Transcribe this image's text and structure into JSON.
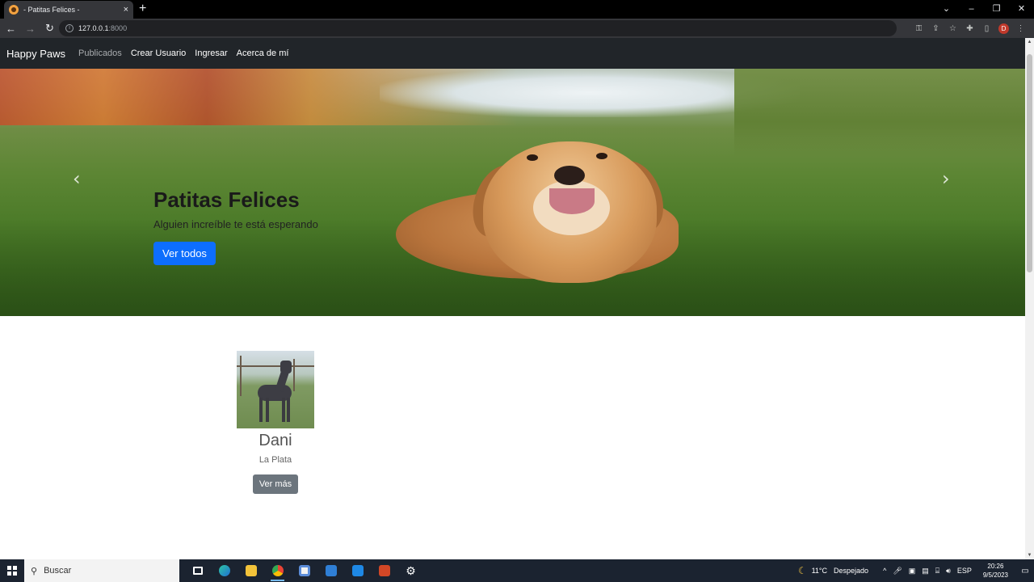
{
  "browser": {
    "tab_title": "- Patitas Felices -",
    "tab_close": "×",
    "new_tab": "+",
    "window_controls": [
      "⌄",
      "–",
      "❐",
      "✕"
    ],
    "url_host": "127.0.0.1",
    "url_port": ":8000",
    "profile_initial": "D",
    "icons": [
      "key-icon",
      "share-icon",
      "star-icon",
      "extensions-icon",
      "sidepanel-icon",
      "menu-icon"
    ]
  },
  "navbar": {
    "brand": "Happy Paws",
    "links": [
      "Publicados",
      "Crear Usuario",
      "Ingresar",
      "Acerca de mí"
    ]
  },
  "hero": {
    "title": "Patitas Felices",
    "subtitle": "Alguien increíble te está esperando",
    "button": "Ver todos",
    "prev_glyph": "‹",
    "next_glyph": "›"
  },
  "cards": [
    {
      "name": "Dani",
      "location": "La Plata",
      "button": "Ver más"
    }
  ],
  "taskbar": {
    "search_placeholder": "Buscar",
    "weather_temp": "11°C",
    "weather_text": "Despejado",
    "language": "ESP",
    "time": "20:26",
    "date": "9/5/2023"
  }
}
